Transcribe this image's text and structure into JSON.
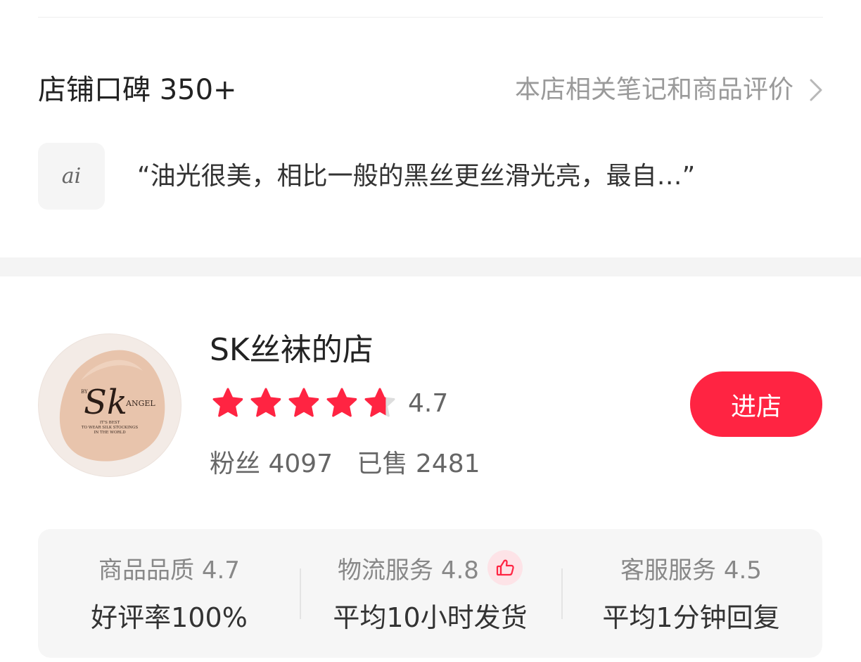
{
  "reviews": {
    "title": "店铺口碑 350+",
    "link_text": "本店相关笔记和商品评价",
    "ai_badge": "ai",
    "ai_summary": "“油光很美，相比一般的黑丝更丝滑光亮，最自…”"
  },
  "shop": {
    "name": "SK丝袜的店",
    "rating": "4.7",
    "rating_stars": 4.7,
    "fans_label": "粉丝",
    "fans_count": "4097",
    "sold_label": "已售",
    "sold_count": "2481",
    "enter_button": "进店",
    "logo": {
      "brand_small": "BY",
      "brand": "Sk",
      "brand_suffix": "ANGEL",
      "tagline_1": "IT'S BEST",
      "tagline_2": "TO WEAR SILK STOCKINGS",
      "tagline_3": "IN THE WORLD"
    }
  },
  "metrics": [
    {
      "label": "商品品质 4.7",
      "value": "好评率100%",
      "thumb": false
    },
    {
      "label": "物流服务 4.8",
      "value": "平均10小时发货",
      "thumb": true,
      "thumb_icon": "thumbs-up-icon"
    },
    {
      "label": "客服服务 4.5",
      "value": "平均1分钟回复",
      "thumb": false
    }
  ],
  "colors": {
    "accent": "#ff2442",
    "star_active": "#ff2442",
    "star_inactive": "#dddddd",
    "text_secondary": "#9a9a9a",
    "card_bg": "#f6f6f6"
  }
}
